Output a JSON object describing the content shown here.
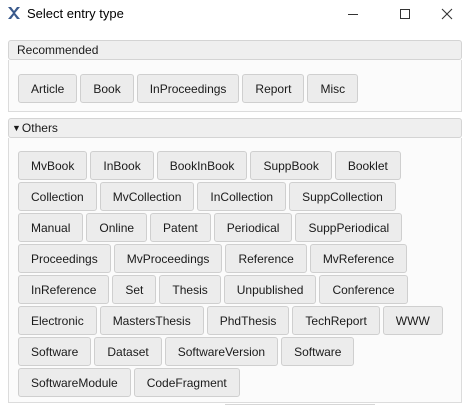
{
  "window": {
    "title": "Select entry type",
    "app_icon": "jabref-icon"
  },
  "recommended": {
    "header": "Recommended",
    "items": [
      "Article",
      "Book",
      "InProceedings",
      "Report",
      "Misc"
    ]
  },
  "others": {
    "header": "Others",
    "rows": [
      [
        "MvBook",
        "InBook",
        "BookInBook",
        "SuppBook",
        "Booklet"
      ],
      [
        "Collection",
        "MvCollection",
        "InCollection",
        "SuppCollection"
      ],
      [
        "Manual",
        "Online",
        "Patent",
        "Periodical",
        "SuppPeriodical"
      ],
      [
        "Proceedings",
        "MvProceedings",
        "Reference",
        "MvReference"
      ],
      [
        "InReference",
        "Set",
        "Thesis",
        "Unpublished",
        "Conference"
      ],
      [
        "Electronic",
        "MastersThesis",
        "PhdThesis",
        "TechReport",
        "WWW"
      ],
      [
        "Software",
        "Dataset",
        "SoftwareVersion",
        "Software"
      ],
      [
        "SoftwareModule",
        "CodeFragment"
      ]
    ]
  }
}
